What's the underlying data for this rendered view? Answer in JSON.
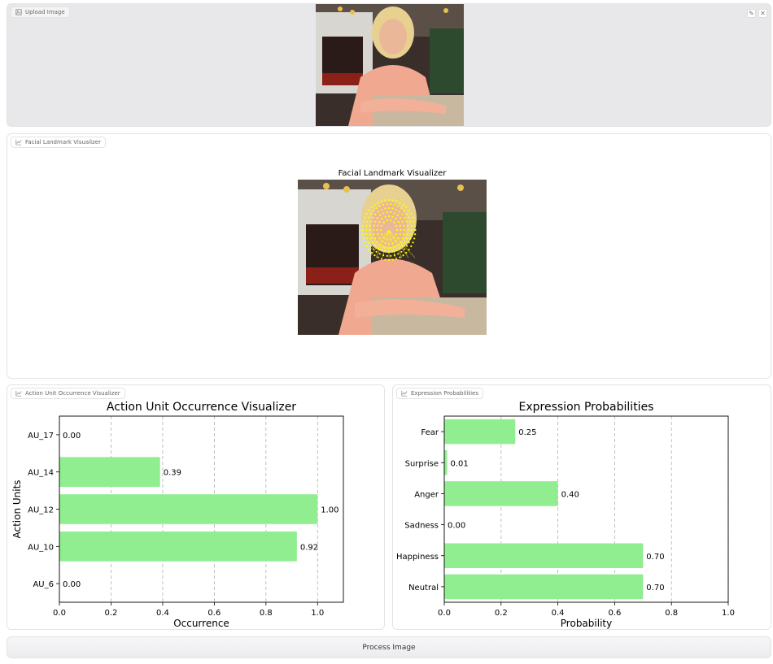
{
  "upload": {
    "label": "Upload Image",
    "edit_icon": "pencil-icon",
    "clear_icon": "close-icon"
  },
  "landmark": {
    "label": "Facial Landmark Visualizer",
    "figure_title": "Facial Landmark Visualizer"
  },
  "au_panel": {
    "label": "Action Unit Occurrence Visualizer"
  },
  "expr_panel": {
    "label": "Expression Probabilities"
  },
  "process_button": "Process Image",
  "colors": {
    "bar": "#90ee90",
    "landmark": "#ffff00",
    "sweater": "#f0a890"
  },
  "chart_data": [
    {
      "type": "bar",
      "orientation": "horizontal",
      "title": "Action Unit Occurrence Visualizer",
      "xlabel": "Occurrence",
      "ylabel": "Action Units",
      "categories": [
        "AU_6",
        "AU_10",
        "AU_12",
        "AU_14",
        "AU_17"
      ],
      "values": [
        0.0,
        0.92,
        1.0,
        0.39,
        0.0
      ],
      "value_labels": [
        "0.00",
        "0.92",
        "1.00",
        "0.39",
        "0.00"
      ],
      "xlim": [
        0,
        1.1
      ],
      "xticks": [
        "0.0",
        "0.2",
        "0.4",
        "0.6",
        "0.8",
        "1.0"
      ],
      "grid": "x-dashed"
    },
    {
      "type": "bar",
      "orientation": "horizontal",
      "title": "Expression Probabilities",
      "xlabel": "Probability",
      "ylabel": "",
      "categories": [
        "Neutral",
        "Happiness",
        "Sadness",
        "Anger",
        "Surprise",
        "Fear"
      ],
      "values": [
        0.7,
        0.7,
        0.0,
        0.4,
        0.01,
        0.25
      ],
      "value_labels": [
        "0.70",
        "0.70",
        "0.00",
        "0.40",
        "0.01",
        "0.25"
      ],
      "xlim": [
        0,
        1.0
      ],
      "xticks": [
        "0.0",
        "0.2",
        "0.4",
        "0.6",
        "0.8",
        "1.0"
      ],
      "grid": "x-dashed"
    }
  ]
}
